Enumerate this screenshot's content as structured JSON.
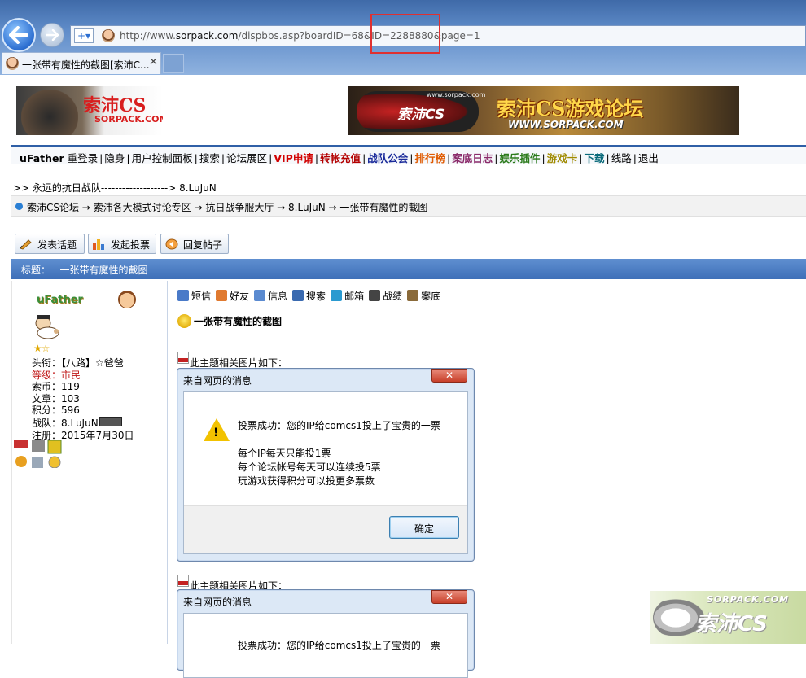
{
  "browser": {
    "url_prefix": "http://www.",
    "url_domain": "sorpack.com",
    "url_path": "/dispbbs.asp?boardID=68&ID=2288880&page=1",
    "tab_title": "一张带有魔性的截图[索沛C...",
    "tab_close": "✕",
    "addr_control": "+▾"
  },
  "header": {
    "logo_text": "索沛CS",
    "logo_sub": "SORPACK.COM",
    "banner_small": "www.sorpack.com",
    "banner_logo": "索沛CS",
    "banner_title": "索沛CS游戏论坛",
    "banner_url": "WWW.SORPACK.COM"
  },
  "menu": {
    "user": "uFather",
    "items": [
      {
        "label": "重登录",
        "color": "#000000",
        "bold": false
      },
      {
        "label": "隐身",
        "color": "#000000",
        "bold": false
      },
      {
        "label": "用户控制面板",
        "color": "#000000",
        "bold": false
      },
      {
        "label": "搜索",
        "color": "#000000",
        "bold": false
      },
      {
        "label": "论坛展区",
        "color": "#000000",
        "bold": false
      },
      {
        "label": "VIP申请",
        "color": "#d10000",
        "bold": true
      },
      {
        "label": "转帐充值",
        "color": "#b30000",
        "bold": true
      },
      {
        "label": "战队公会",
        "color": "#1a2a9a",
        "bold": true
      },
      {
        "label": "排行榜",
        "color": "#e05a00",
        "bold": true
      },
      {
        "label": "案底日志",
        "color": "#8a2a6a",
        "bold": true
      },
      {
        "label": "娱乐插件",
        "color": "#2a7a1a",
        "bold": true
      },
      {
        "label": "游戏卡",
        "color": "#a08a00",
        "bold": true
      },
      {
        "label": "下载",
        "color": "#0a6a7a",
        "bold": true
      },
      {
        "label": "线路",
        "color": "#000000",
        "bold": false
      },
      {
        "label": "退出",
        "color": "#000000",
        "bold": false
      }
    ]
  },
  "breadcrumb": {
    "line1": ">> 永远的抗日战队-------------------> 8.LuJuN",
    "line2": "索沛CS论坛 → 索沛各大模式讨论专区 → 抗日战争服大厅 → 8.LuJuN → 一张带有魔性的截图"
  },
  "actions": {
    "post": "发表话题",
    "poll": "发起投票",
    "reply": "回复帖子"
  },
  "topic": {
    "label": "标题：",
    "title": "一张带有魔性的截图"
  },
  "user": {
    "name": "uFather",
    "stars": "★☆",
    "title_label": "头衔：",
    "title_value": "【八路】☆爸爸",
    "level_label": "等级：",
    "level_value": "市民",
    "coins_label": "索币：",
    "coins_value": "119",
    "posts_label": "文章：",
    "posts_value": "103",
    "points_label": "积分：",
    "points_value": "596",
    "team_label": "战队：",
    "team_value": "8.LuJuN",
    "reg_label": "注册：",
    "reg_value": "2015年7月30日"
  },
  "post_tools": [
    "短信",
    "好友",
    "信息",
    "搜索",
    "邮箱",
    "战绩",
    "案底"
  ],
  "post": {
    "title": "一张带有魔性的截图",
    "caption1": "此主题相关图片如下：",
    "caption2": "此主题相关图片如下："
  },
  "dialog": {
    "title": "来自网页的消息",
    "close": "✕",
    "line1": "投票成功：您的IP给comcs1投上了宝贵的一票",
    "line2": "每个IP每天只能投1票",
    "line3": "每个论坛帐号每天可以连续投5票",
    "line4": "玩游戏获得积分可以投更多票数",
    "ok": "确定",
    "warn_mark": "!",
    "partial_line": "投票成功：您的IP给comcs1投上了宝贵的一票"
  },
  "watermark": {
    "top": "SORPACK.COM",
    "logo": "索沛CS"
  }
}
